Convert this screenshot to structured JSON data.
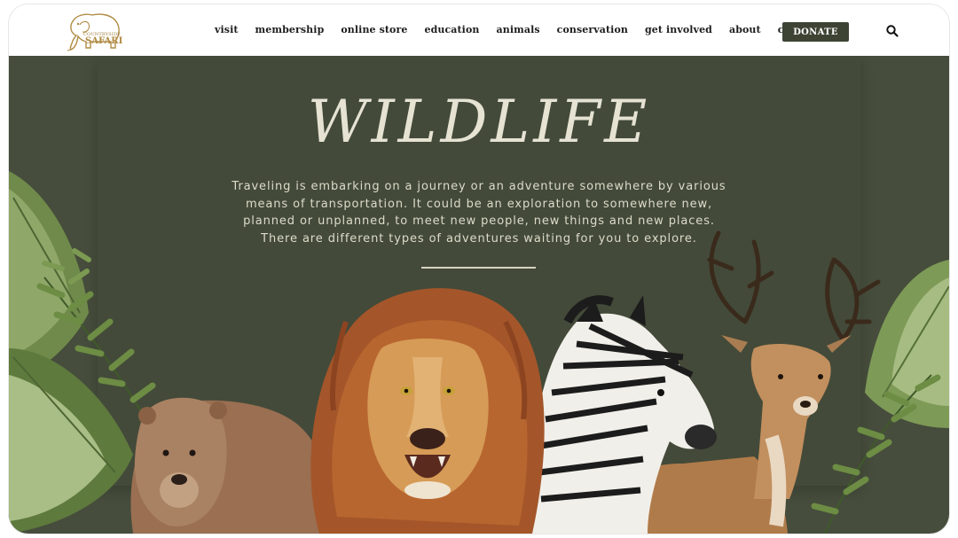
{
  "brand": {
    "logo_line1": "COUNTRYSIDE",
    "logo_line2": "SAFARI"
  },
  "nav": {
    "items": [
      "visit",
      "membership",
      "online store",
      "education",
      "animals",
      "conservation",
      "get involved",
      "about",
      "contact"
    ]
  },
  "actions": {
    "donate_label": "DONATE",
    "search_icon": "search-icon"
  },
  "hero": {
    "title": "WILDLIFE",
    "description": "Traveling is embarking on a journey or an adventure somewhere by various means of transportation. It could be an exploration to somewhere new, planned or unplanned, to meet new people, new things and new places. There are different types of adventures waiting for you to explore.",
    "illustration": [
      "palm-leaf",
      "fern",
      "bear",
      "lion",
      "zebra",
      "deer"
    ]
  },
  "colors": {
    "brand_dark": "#3d4434",
    "hero_bg": "#464d3c",
    "text_light": "#e6e3d3",
    "logo_gold": "#b08b44"
  }
}
